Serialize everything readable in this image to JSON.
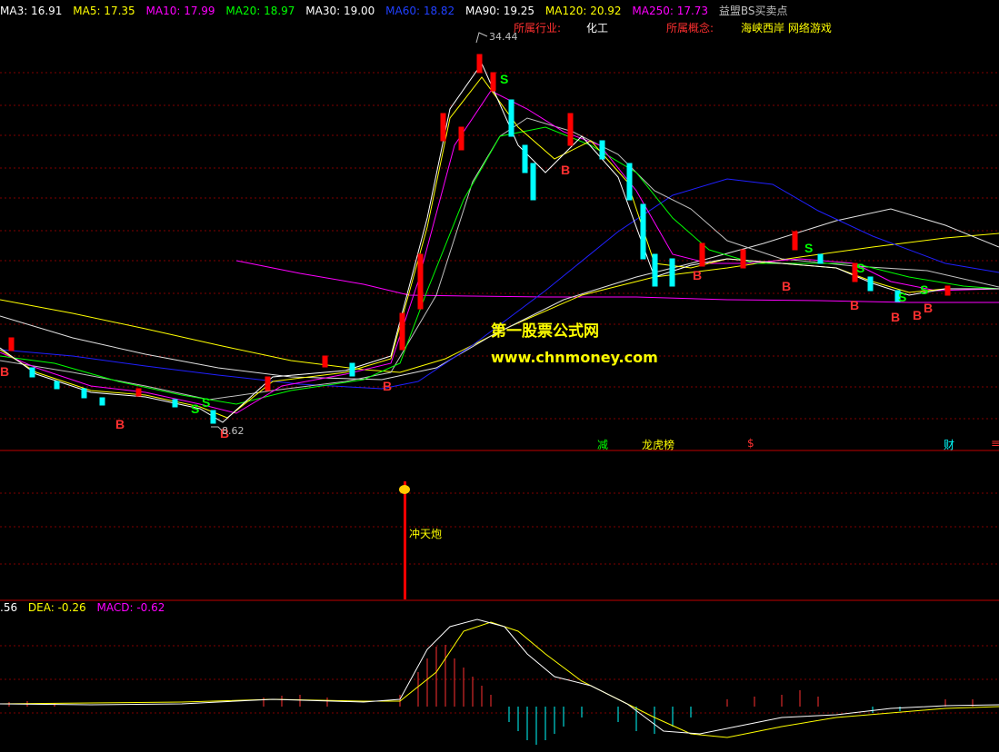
{
  "header": {
    "ma3": "MA3: 16.91",
    "ma5": "MA5: 17.35",
    "ma10": "MA10: 17.99",
    "ma20": "MA20: 18.97",
    "ma30": "MA30: 19.00",
    "ma60": "MA60: 18.82",
    "ma90": "MA90: 19.25",
    "ma120": "MA120: 20.92",
    "ma250": "MA250: 17.73",
    "indicator": "益盟BS买卖点"
  },
  "info": {
    "industry_label": "所属行业:",
    "industry_value": "化工",
    "concept_label": "所属概念:",
    "concept_value": "海峡西岸 网络游戏"
  },
  "price_labels": {
    "high": "34.44",
    "low": "8.62"
  },
  "watermark": {
    "line1": "第一股票公式网",
    "line2": "www.chnmoney.com"
  },
  "events": [
    "减",
    "龙虎榜",
    "$",
    "财",
    "≡"
  ],
  "signal": {
    "label": "冲天炮"
  },
  "macd": {
    "diff": ".56",
    "dea": "DEA: -0.26",
    "macd": "MACD: -0.62"
  },
  "bs_markers": {
    "buy": "B",
    "sell": "S"
  },
  "colors": {
    "ma3": "#ffffff",
    "ma5": "#ffff00",
    "ma10": "#ff00ff",
    "ma20": "#00ff00",
    "ma30": "#ffffff",
    "ma60": "#0000ff",
    "ma90": "#ffffff",
    "ma120": "#ff00ff",
    "ma250": "#ff00ff",
    "up": "#ff0000",
    "down": "#00ffff",
    "grid": "#800000"
  }
}
